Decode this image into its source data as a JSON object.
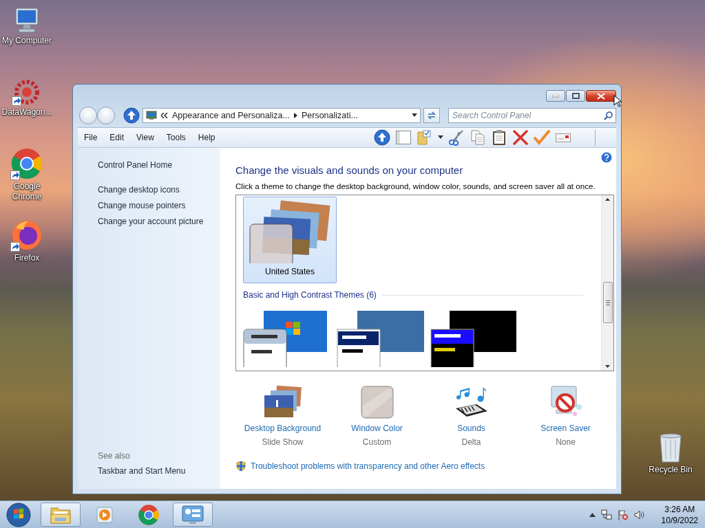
{
  "desktop_icons": [
    {
      "label": "My Computer",
      "kind": "computer",
      "shortcut": false
    },
    {
      "label": "DataWagon...",
      "kind": "gear",
      "shortcut": true
    },
    {
      "label": "Google Chrome",
      "kind": "chrome",
      "shortcut": true
    },
    {
      "label": "Firefox",
      "kind": "firefox",
      "shortcut": true
    },
    {
      "label": "Recycle Bin",
      "kind": "bin",
      "shortcut": false
    }
  ],
  "window": {
    "address": {
      "crumbs": [
        "Appearance and Personaliza...",
        "Personalizati..."
      ]
    },
    "search": {
      "placeholder": "Search Control Panel"
    },
    "menu": [
      "File",
      "Edit",
      "View",
      "Tools",
      "Help"
    ],
    "sidebar": {
      "links": [
        "Control Panel Home",
        "Change desktop icons",
        "Change mouse pointers",
        "Change your account picture"
      ],
      "see_also_title": "See also",
      "see_also": [
        "Taskbar and Start Menu"
      ]
    },
    "heading": "Change the visuals and sounds on your computer",
    "intro": "Click a theme to change the desktop background, window color, sounds, and screen saver all at once.",
    "themes": {
      "items": [
        {
          "label": "United States",
          "selected": true
        }
      ],
      "group_title": "Basic and High Contrast Themes (6)",
      "basic": [
        {
          "kind": "aero"
        },
        {
          "kind": "classic"
        },
        {
          "kind": "contrast"
        }
      ]
    },
    "settings": [
      {
        "label": "Desktop Background",
        "value": "Slide Show",
        "kind": "background"
      },
      {
        "label": "Window Color",
        "value": "Custom",
        "kind": "color"
      },
      {
        "label": "Sounds",
        "value": "Delta",
        "kind": "sounds"
      },
      {
        "label": "Screen Saver",
        "value": "None",
        "kind": "saver"
      }
    ],
    "troubleshoot": "Troubleshoot problems with transparency and other Aero effects"
  },
  "taskbar": {
    "apps": [
      {
        "kind": "explorer",
        "active": true
      },
      {
        "kind": "media",
        "active": false
      },
      {
        "kind": "chrome",
        "active": false
      },
      {
        "kind": "control-panel",
        "active": true
      }
    ],
    "clock": {
      "time": "3:26 AM",
      "date": "10/9/2022"
    }
  }
}
